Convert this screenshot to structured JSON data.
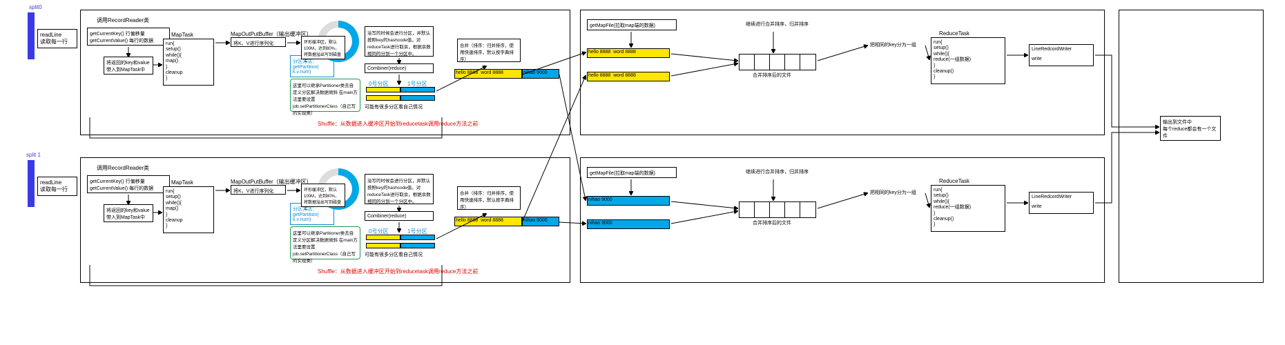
{
  "labels": {
    "split0": "split0",
    "split1": "split 1",
    "readLine1": "readLine",
    "readLine2": "读取每一行",
    "recordReader": "调用RecordReader类",
    "getCurrentKey": "getCurrentKey()    行偏移量",
    "getCurrentValue": "getCurrentValue() 每行的数据",
    "sendToMap": "将返回的key和value带入到MapTask中",
    "mapTask": "MapTask",
    "mapCode1": "run{",
    "mapCode2": "  setup()",
    "mapCode3": "  while(){",
    "mapCode4": "    map()",
    "mapCode5": "  }",
    "mapCode6": "  cleanup",
    "mapCode7": "}",
    "outputBuffer": "MapOutPutBuffer（输出缓冲区）",
    "serialize": "将K、V进行序列化",
    "partitionMethod1": "分区方法：",
    "partitionMethod2": "getPartition(",
    "partitionMethod3": "  k.v.num)",
    "ringBuffer1": "环形缓冲区，默认100M，达到80%，将数据溢出写到磁盘上",
    "writePartition1": "溢写的时候会进行分区，并默认按照key的hashcode值，对reduceTask进行取余，根据余数相同的分到一个分区中。",
    "combiner": "Combiner(reduce)",
    "partitionNote": "这里可以继承Partitioner类去自定义分区解决数据倾斜 在main方法里要设置 job.setPartitionerClass（自己写的实现类）",
    "part0": "0号分区",
    "part1": "1号分区",
    "mergeNote": "可能有很多分区看自己情况",
    "merge1": "合并（排序：归并排序，使用快速排序，默认按字典排序）",
    "shuffle": "Shuffle：从数据进入缓冲区开始到reducetask调用reduce方法之前",
    "hello8888": "hello  8888",
    "word8888": "word 8888",
    "nihao9000": "nihao 9000",
    "getMapFile": "getMapFile(拉取map端的数据)",
    "mergeSort": "继续进行合并排序，归并排序",
    "mergedFile": "合并排序后的文件",
    "groupByKey": "把相同的key分为一组",
    "reduceTask": "ReduceTask",
    "reduceCode1": "run{",
    "reduceCode2": "  setup()",
    "reduceCode3": "  while(){",
    "reduceCode4": "    reduce(一组数据)",
    "reduceCode5": "  }",
    "reduceCode6": "  cleanup()",
    "reduceCode7": "}",
    "lineWriter": "LineRedcordWriter",
    "write": "write",
    "outputFile1": "输出到文件中",
    "outputFile2": "每个reduce都会有一个文件"
  }
}
